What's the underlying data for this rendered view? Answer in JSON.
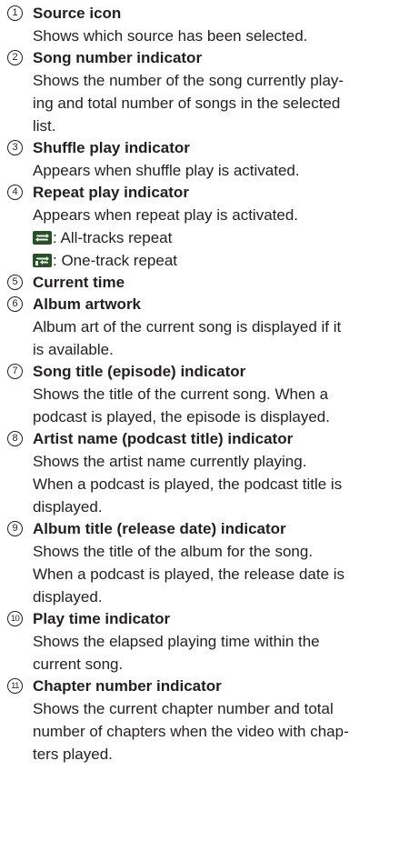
{
  "items": [
    {
      "num": "1",
      "title": "Source icon",
      "desc": [
        "Shows which source has been selected."
      ]
    },
    {
      "num": "2",
      "title": "Song number indicator",
      "desc": [
        "Shows the number of the song currently play-",
        "ing and total number of songs in the selected",
        "list."
      ]
    },
    {
      "num": "3",
      "title": "Shuffle play indicator",
      "desc": [
        "Appears when shuffle play is activated."
      ]
    },
    {
      "num": "4",
      "title": "Repeat play indicator",
      "desc": [
        "Appears when repeat play is activated."
      ],
      "sub": [
        {
          "icon": "all-tracks-repeat-icon",
          "text": ": All-tracks repeat"
        },
        {
          "icon": "one-track-repeat-icon",
          "text": ": One-track repeat"
        }
      ]
    },
    {
      "num": "5",
      "title": "Current time",
      "desc": []
    },
    {
      "num": "6",
      "title": "Album artwork",
      "desc": [
        "Album art of the current song is displayed if it",
        "is available."
      ]
    },
    {
      "num": "7",
      "title": "Song title (episode) indicator",
      "desc": [
        "Shows the title of the current song. When a",
        "podcast is played, the episode is displayed."
      ]
    },
    {
      "num": "8",
      "title": "Artist name (podcast title) indicator",
      "desc": [
        "Shows the artist name currently playing.",
        "When a podcast is played, the podcast title is",
        "displayed."
      ]
    },
    {
      "num": "9",
      "title": "Album title (release date) indicator",
      "desc": [
        "Shows the title of the album for the song.",
        "When a podcast is played, the release date is",
        "displayed."
      ]
    },
    {
      "num": "10",
      "title": "Play time indicator",
      "desc": [
        "Shows the elapsed playing time within the",
        "current song."
      ]
    },
    {
      "num": "11",
      "title": "Chapter number indicator",
      "desc": [
        "Shows the current chapter number and total",
        "number of chapters when the video with chap-",
        "ters played."
      ]
    }
  ]
}
